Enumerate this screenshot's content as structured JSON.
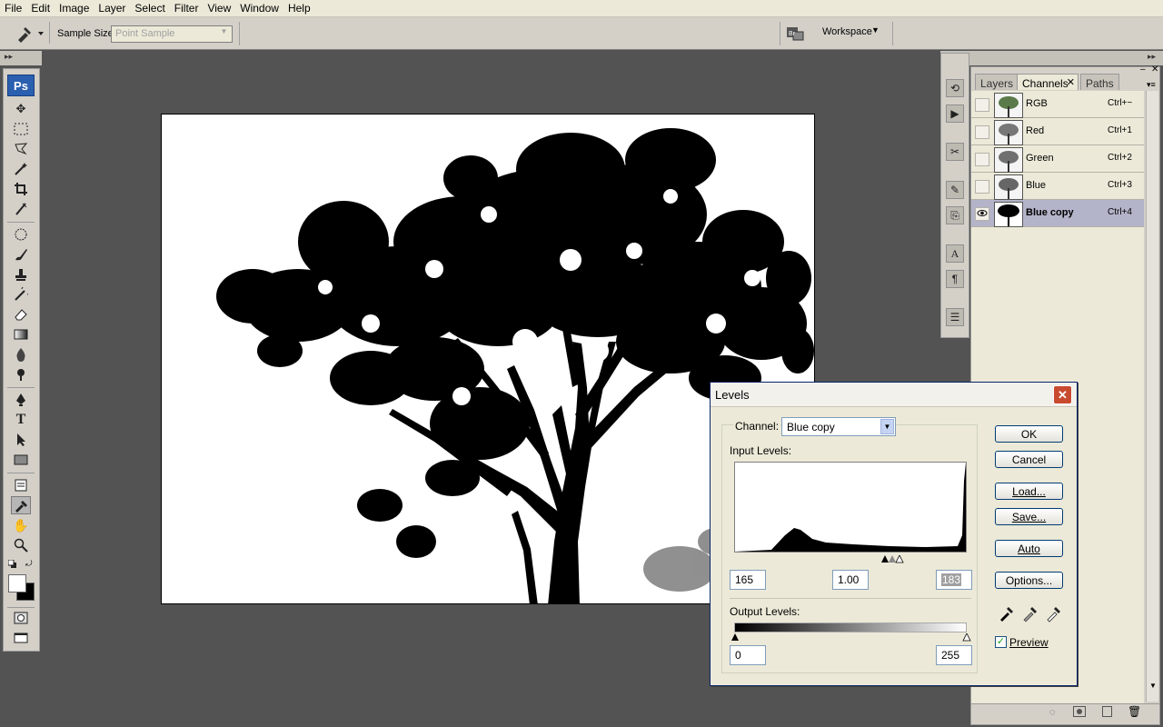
{
  "menu": [
    "File",
    "Edit",
    "Image",
    "Layer",
    "Select",
    "Filter",
    "View",
    "Window",
    "Help"
  ],
  "options_bar": {
    "sample_size_label": "Sample Size:",
    "sample_size_value": "Point Sample",
    "workspace_label": "Workspace"
  },
  "toolbox": {
    "logo": "Ps"
  },
  "panel": {
    "tabs": [
      {
        "label": "Layers",
        "active": false
      },
      {
        "label": "Channels",
        "active": true
      },
      {
        "label": "Paths",
        "active": false
      }
    ],
    "channels": [
      {
        "name": "RGB",
        "shortcut": "Ctrl+~",
        "visible": false,
        "selected": false
      },
      {
        "name": "Red",
        "shortcut": "Ctrl+1",
        "visible": false,
        "selected": false
      },
      {
        "name": "Green",
        "shortcut": "Ctrl+2",
        "visible": false,
        "selected": false
      },
      {
        "name": "Blue",
        "shortcut": "Ctrl+3",
        "visible": false,
        "selected": false
      },
      {
        "name": "Blue copy",
        "shortcut": "Ctrl+4",
        "visible": true,
        "selected": true
      }
    ]
  },
  "levels_dialog": {
    "title": "Levels",
    "channel_label": "Channel:",
    "channel_value": "Blue copy",
    "input_levels_label": "Input Levels:",
    "input_black": "165",
    "input_gamma": "1.00",
    "input_white": "183",
    "output_levels_label": "Output Levels:",
    "output_black": "0",
    "output_white": "255",
    "buttons": {
      "ok": "OK",
      "cancel": "Cancel",
      "load": "Load...",
      "save": "Save...",
      "auto": "Auto",
      "options": "Options..."
    },
    "preview_label": "Preview",
    "preview_checked": true
  },
  "colors": {
    "workspace_bg": "#535353",
    "ps_logo_bg": "#2b5fb0",
    "dialog_close": "#c84a2f",
    "selected_row": "#b3b3c9"
  }
}
